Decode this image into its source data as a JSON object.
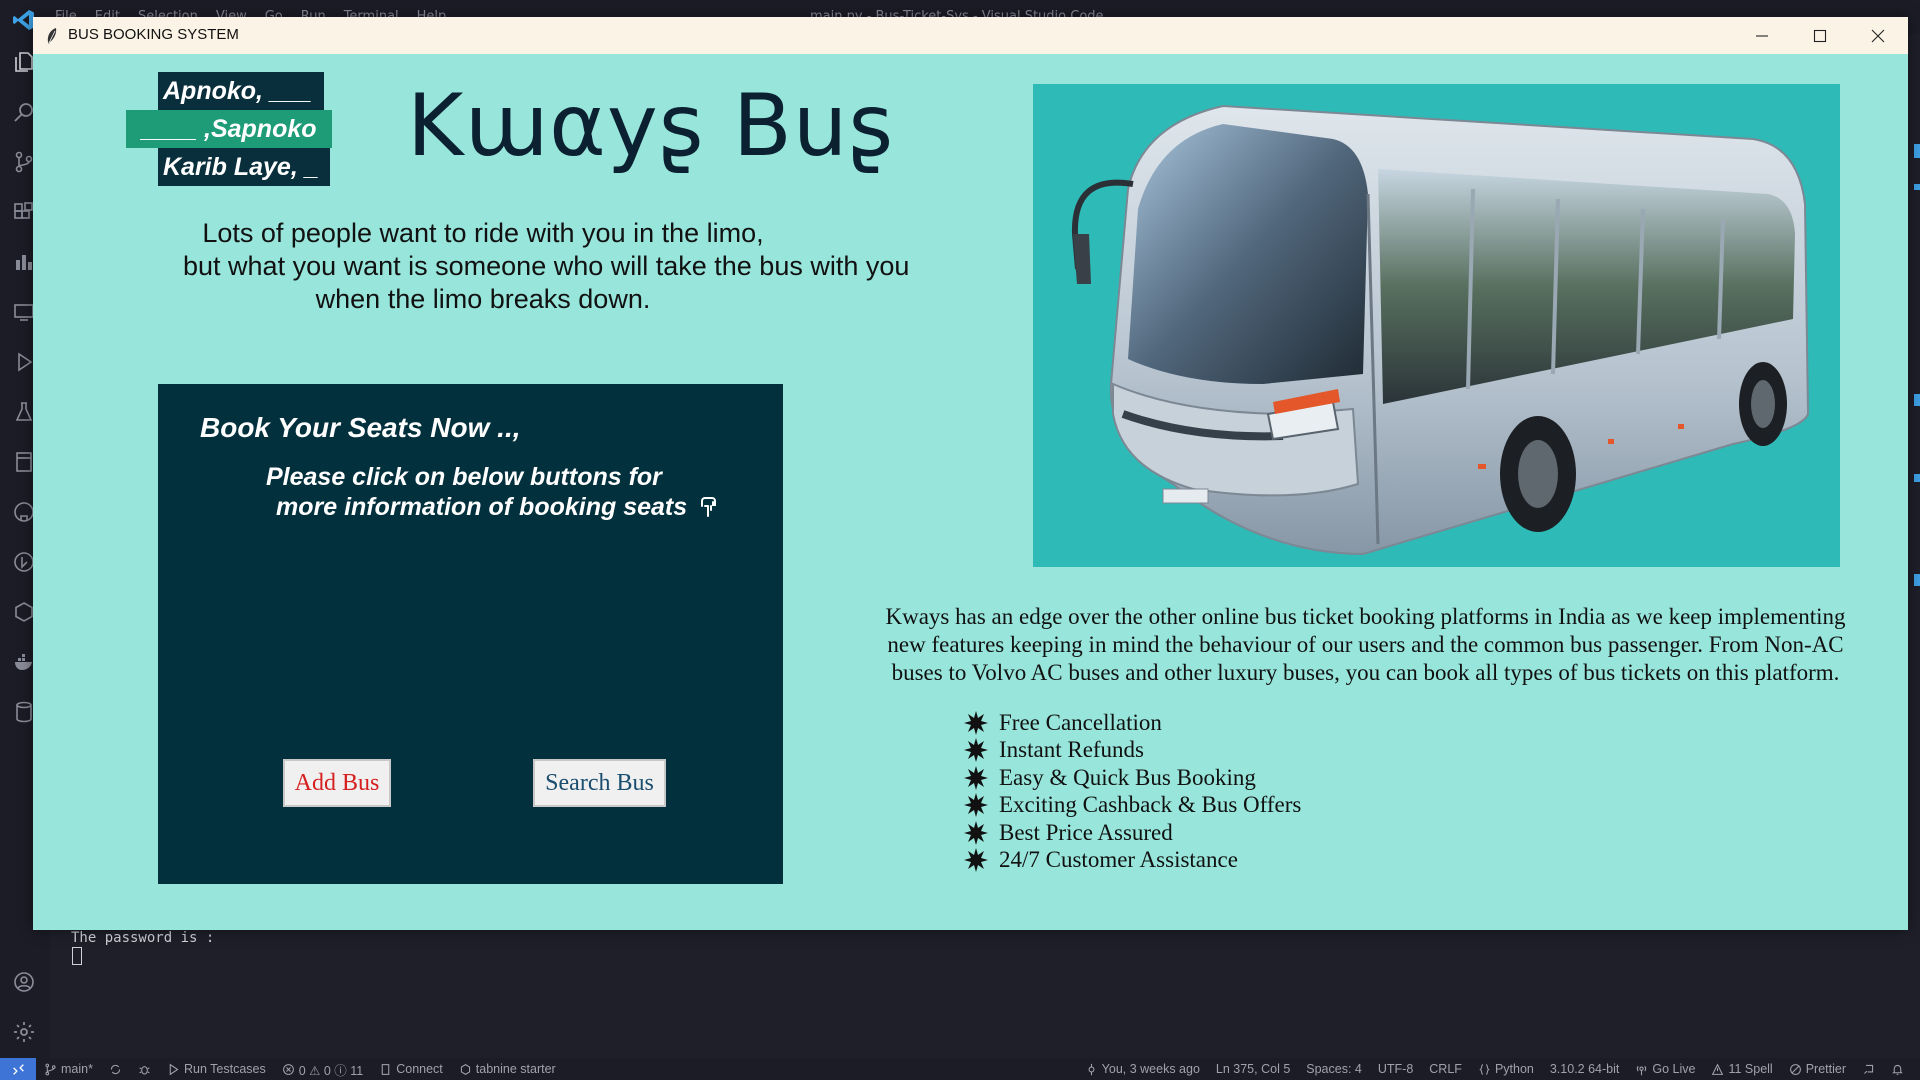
{
  "vscode": {
    "menu": [
      "File",
      "Edit",
      "Selection",
      "View",
      "Go",
      "Run",
      "Terminal",
      "Help"
    ],
    "window_title": "main.py - Bus-Ticket-Sys - Visual Studio Code",
    "terminal_lines": [
      "The password is :"
    ],
    "status_bar": {
      "branch": "main*",
      "run_testcases": "Run Testcases",
      "problems": "0 ⚠ 0 ⓘ 11",
      "connect": "Connect",
      "tabnine": "tabnine starter",
      "blame": "You, 3 weeks ago",
      "cursor": "Ln 375, Col 5",
      "spaces": "Spaces: 4",
      "encoding": "UTF-8",
      "eol": "CRLF",
      "language": "Python",
      "interpreter": "3.10.2 64-bit",
      "golive": "Go Live",
      "spell": "11 Spell",
      "prettier": "Prettier"
    }
  },
  "app": {
    "title": "BUS BOOKING SYSTEM",
    "tags": [
      "Apnoko, ___",
      "____ ,Sapnoko",
      "Karib Laye, _"
    ],
    "brand": "Kɯαуʂ Buʂ",
    "quote": [
      "Lots of people want to ride with you in the limo,",
      "but what you want is someone who will take the bus with you",
      "when the limo breaks down."
    ],
    "booking": {
      "title": "Book Your Seats Now ..,",
      "subtitle_1": "Please click on below buttons for",
      "subtitle_2": "more information of booking seats",
      "add_label": "Add Bus",
      "search_label": "Search Bus"
    },
    "about": [
      "Kways has an edge over the other online bus ticket booking platforms in India as we keep implementing",
      "new features keeping in mind the behaviour of our users and the common bus passenger. From Non-AC",
      "buses to Volvo AC buses and other luxury buses, you can book all types of bus tickets on this platform."
    ],
    "features": [
      "Free Cancellation",
      "Instant Refunds",
      "Easy & Quick Bus Booking",
      "Exciting Cashback & Bus Offers",
      "Best Price Assured",
      "24/7 Customer Assistance"
    ]
  },
  "colors": {
    "window_bg": "#97e5db",
    "panel_bg": "#03303d",
    "photo_bg": "#2ebab7",
    "tag_dark": "#0a2f3c",
    "tag_green": "#1e9c78",
    "add_text": "#d62020",
    "search_text": "#1a4d6e"
  }
}
